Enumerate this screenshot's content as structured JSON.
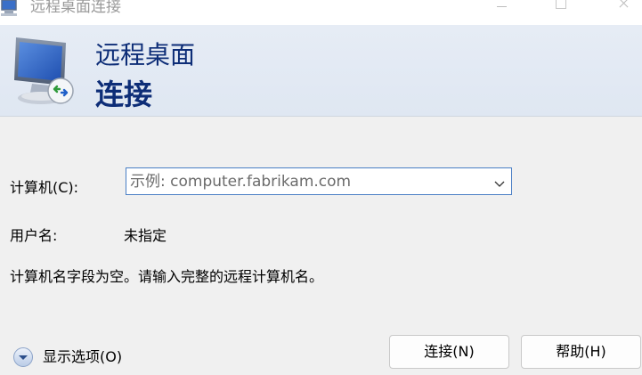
{
  "window": {
    "title": "远程桌面连接"
  },
  "banner": {
    "line1": "远程桌面",
    "line2": "连接"
  },
  "form": {
    "computer_label": "计算机(C):",
    "computer_placeholder": "示例: computer.fabrikam.com",
    "computer_value": "",
    "user_label": "用户名:",
    "user_value": "未指定",
    "message": "计算机名字段为空。请输入完整的远程计算机名。"
  },
  "footer": {
    "show_options_label": "显示选项(O)",
    "connect_label": "连接(N)",
    "help_label": "帮助(H)"
  },
  "colors": {
    "banner_text": "#0d2d77",
    "input_border": "#4a7fc5",
    "banner_bg": "#e1e8f3"
  }
}
